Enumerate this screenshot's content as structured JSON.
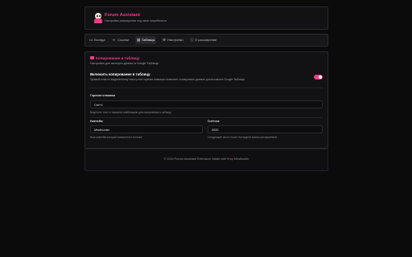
{
  "header": {
    "title": "Forum Assistant",
    "subtitle": "Настройки расширения под свои потребности",
    "avatar_icon": "avatar-icon"
  },
  "tabs": [
    {
      "label": "Беседа",
      "icon": "message-icon",
      "active": false
    },
    {
      "label": "Ссылки",
      "icon": "link-icon",
      "active": false
    },
    {
      "label": "Таблицы",
      "icon": "table-icon",
      "active": true
    },
    {
      "label": "Настройки",
      "icon": "gear-icon",
      "active": false
    },
    {
      "label": "О расширении",
      "icon": "info-icon",
      "active": false
    }
  ],
  "panel": {
    "title": "Копирование в таблицу",
    "description": "Настройки для экспорта данных в Google Таблицы",
    "toggle": {
      "label": "Включить копирование в таблицу",
      "description": "Правый клик по выделенному тексту или горячая клавиша позволяет скопировать данные для вставки в Google Таблицы",
      "enabled": true
    },
    "hotkey": {
      "label": "Горячая клавиша",
      "value": "Ctrl+X",
      "help": "Выделите текст и нажмите комбинацию для копирования в таблицу"
    },
    "nickname": {
      "label": "Никнейм",
      "value": "Mindhunter",
      "help": "Ваш никнейм который запишется в колонке"
    },
    "counter": {
      "label": "Счётчик",
      "value": "2000",
      "help": "Следующее число после последней записи расширением"
    }
  },
  "footer": {
    "prefix": "© 2024 Forum Assistant Extension. Made with",
    "suffix": "by Mindhunter"
  },
  "colors": {
    "accent": "#ea3f86",
    "background": "#0b0b0c",
    "panel": "#121214"
  }
}
